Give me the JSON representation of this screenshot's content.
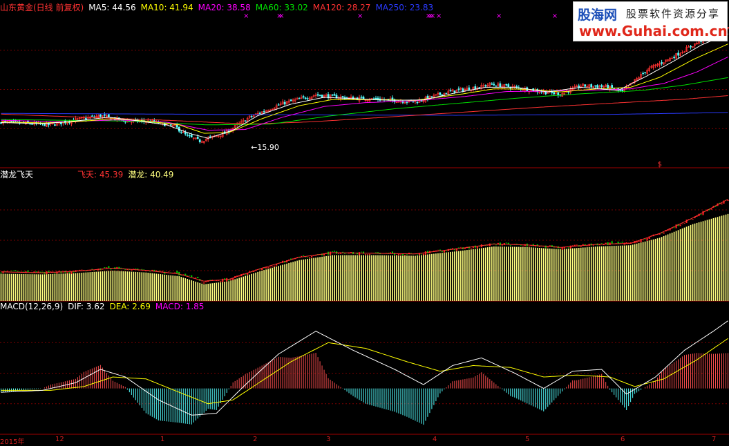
{
  "colors": {
    "background": "#000000",
    "grid": "#7a0000",
    "up_candle": "#ff3232",
    "down_candle": "#54ffff",
    "ma5": "#ffffff",
    "ma10": "#ffff00",
    "ma20": "#ff00ff",
    "ma60": "#00e000",
    "ma120": "#ff3232",
    "ma250": "#2a3aff",
    "feitian": "#ff3232",
    "qianlong": "#ffff80",
    "dif": "#ffffff",
    "dea": "#ffff00",
    "macd": "#ff00ff",
    "macd_pos": "#ff5050",
    "macd_neg": "#54ffff",
    "signal_mark": "#ff00ff"
  },
  "main_panel": {
    "title": "山东黄金(日线 前复权)",
    "indicators": [
      {
        "label": "MA5:",
        "value": "44.56",
        "color": "#ffffff"
      },
      {
        "label": "MA10:",
        "value": "41.94",
        "color": "#ffff00"
      },
      {
        "label": "MA20:",
        "value": "38.58",
        "color": "#ff00ff"
      },
      {
        "label": "MA60:",
        "value": "33.02",
        "color": "#00e000"
      },
      {
        "label": "MA120:",
        "value": "28.27",
        "color": "#ff3232"
      },
      {
        "label": "MA250:",
        "value": "23.83",
        "color": "#2a3aff"
      }
    ],
    "min_annotation": "←15.90",
    "signal_glyph": "×",
    "dollar_mark": "$"
  },
  "indicator_panel": {
    "title": "潜龙飞天",
    "values": [
      {
        "label": "飞天:",
        "value": "45.39",
        "color": "#ff3232"
      },
      {
        "label": "潜龙:",
        "value": "40.49",
        "color": "#ffff80"
      }
    ]
  },
  "macd_panel": {
    "title": "MACD(12,26,9)",
    "values": [
      {
        "label": "DIF:",
        "value": "3.62",
        "color": "#ffffff"
      },
      {
        "label": "DEA:",
        "value": "2.69",
        "color": "#ffff00"
      },
      {
        "label": "MACD:",
        "value": "1.85",
        "color": "#ff00ff"
      }
    ]
  },
  "watermark": {
    "logo": "股海网",
    "slogan": "股票软件资源分享",
    "url": "www.Guhai.com.cn"
  },
  "date_axis": [
    "2015年",
    "12",
    "1",
    "2",
    "3",
    "4",
    "5",
    "6",
    "7"
  ],
  "chart_data": {
    "type": "candlestick",
    "series_anchor_points": {
      "close": [
        [
          0,
          21.4
        ],
        [
          12,
          21.0
        ],
        [
          24,
          20.6
        ],
        [
          36,
          21.9
        ],
        [
          48,
          23.0
        ],
        [
          60,
          21.6
        ],
        [
          72,
          21.5
        ],
        [
          84,
          20.2
        ],
        [
          90,
          17.6
        ],
        [
          96,
          16.4
        ],
        [
          108,
          18.4
        ],
        [
          120,
          22.6
        ],
        [
          136,
          26.2
        ],
        [
          152,
          28.4
        ],
        [
          168,
          27.6
        ],
        [
          184,
          27.2
        ],
        [
          200,
          26.6
        ],
        [
          216,
          29.2
        ],
        [
          232,
          30.6
        ],
        [
          236,
          31.2
        ],
        [
          248,
          30.4
        ],
        [
          262,
          29.2
        ],
        [
          270,
          28.6
        ],
        [
          280,
          30.8
        ],
        [
          292,
          30.6
        ],
        [
          300,
          29.2
        ],
        [
          312,
          35.0
        ],
        [
          324,
          38.2
        ],
        [
          336,
          42.0
        ],
        [
          344,
          44.6
        ],
        [
          352,
          46.6
        ]
      ],
      "ma5": [
        [
          0,
          21.2
        ],
        [
          20,
          20.9
        ],
        [
          36,
          21.6
        ],
        [
          52,
          22.6
        ],
        [
          64,
          21.8
        ],
        [
          80,
          20.6
        ],
        [
          92,
          18.2
        ],
        [
          100,
          17.1
        ],
        [
          112,
          19.2
        ],
        [
          124,
          23.0
        ],
        [
          140,
          26.0
        ],
        [
          156,
          27.8
        ],
        [
          172,
          27.4
        ],
        [
          188,
          27.0
        ],
        [
          204,
          27.1
        ],
        [
          220,
          29.0
        ],
        [
          234,
          30.4
        ],
        [
          248,
          30.4
        ],
        [
          264,
          29.2
        ],
        [
          280,
          30.4
        ],
        [
          298,
          29.6
        ],
        [
          312,
          33.4
        ],
        [
          326,
          37.6
        ],
        [
          338,
          41.4
        ],
        [
          352,
          44.56
        ]
      ],
      "ma10": [
        [
          0,
          21.4
        ],
        [
          20,
          21.1
        ],
        [
          36,
          21.4
        ],
        [
          54,
          22.2
        ],
        [
          70,
          21.6
        ],
        [
          86,
          20.6
        ],
        [
          98,
          18.4
        ],
        [
          110,
          18.6
        ],
        [
          126,
          22.2
        ],
        [
          144,
          25.6
        ],
        [
          160,
          27.2
        ],
        [
          180,
          27.2
        ],
        [
          200,
          27.0
        ],
        [
          222,
          28.6
        ],
        [
          238,
          30.0
        ],
        [
          254,
          29.9
        ],
        [
          270,
          29.2
        ],
        [
          288,
          30.0
        ],
        [
          304,
          30.4
        ],
        [
          318,
          33.0
        ],
        [
          334,
          37.6
        ],
        [
          352,
          41.94
        ]
      ],
      "ma20": [
        [
          0,
          21.8
        ],
        [
          30,
          21.4
        ],
        [
          56,
          21.9
        ],
        [
          80,
          21.3
        ],
        [
          100,
          19.2
        ],
        [
          118,
          19.4
        ],
        [
          136,
          22.6
        ],
        [
          156,
          25.4
        ],
        [
          176,
          26.4
        ],
        [
          200,
          26.9
        ],
        [
          224,
          28.0
        ],
        [
          244,
          29.3
        ],
        [
          264,
          29.4
        ],
        [
          288,
          29.7
        ],
        [
          304,
          30.0
        ],
        [
          320,
          31.4
        ],
        [
          336,
          34.4
        ],
        [
          352,
          38.58
        ]
      ],
      "ma60": [
        [
          0,
          22.0
        ],
        [
          60,
          21.6
        ],
        [
          100,
          20.6
        ],
        [
          130,
          20.8
        ],
        [
          160,
          23.0
        ],
        [
          190,
          24.8
        ],
        [
          220,
          26.2
        ],
        [
          250,
          27.6
        ],
        [
          280,
          28.7
        ],
        [
          310,
          29.6
        ],
        [
          330,
          31.0
        ],
        [
          352,
          33.02
        ]
      ],
      "ma120": [
        [
          0,
          23.4
        ],
        [
          40,
          22.6
        ],
        [
          80,
          21.8
        ],
        [
          120,
          20.8
        ],
        [
          150,
          21.4
        ],
        [
          180,
          22.4
        ],
        [
          220,
          23.8
        ],
        [
          260,
          25.2
        ],
        [
          300,
          26.4
        ],
        [
          330,
          27.3
        ],
        [
          352,
          28.27
        ]
      ],
      "ma250": [
        [
          0,
          23.6
        ],
        [
          80,
          23.4
        ],
        [
          150,
          23.2
        ],
        [
          220,
          23.1
        ],
        [
          290,
          23.3
        ],
        [
          352,
          23.83
        ]
      ],
      "dif": [
        [
          0,
          -0.2
        ],
        [
          20,
          -0.1
        ],
        [
          36,
          0.3
        ],
        [
          48,
          1.0
        ],
        [
          60,
          0.6
        ],
        [
          76,
          -0.6
        ],
        [
          92,
          -1.4
        ],
        [
          104,
          -1.3
        ],
        [
          118,
          0.2
        ],
        [
          134,
          1.8
        ],
        [
          152,
          3.0
        ],
        [
          170,
          2.0
        ],
        [
          190,
          1.0
        ],
        [
          204,
          0.2
        ],
        [
          218,
          1.2
        ],
        [
          232,
          1.6
        ],
        [
          248,
          0.8
        ],
        [
          262,
          0.0
        ],
        [
          276,
          0.9
        ],
        [
          290,
          1.0
        ],
        [
          302,
          -0.3
        ],
        [
          316,
          0.6
        ],
        [
          330,
          2.0
        ],
        [
          344,
          3.0
        ],
        [
          352,
          3.62
        ]
      ],
      "dea": [
        [
          0,
          -0.1
        ],
        [
          24,
          -0.1
        ],
        [
          40,
          0.1
        ],
        [
          54,
          0.6
        ],
        [
          70,
          0.5
        ],
        [
          86,
          -0.2
        ],
        [
          100,
          -0.8
        ],
        [
          112,
          -0.6
        ],
        [
          126,
          0.4
        ],
        [
          140,
          1.4
        ],
        [
          158,
          2.4
        ],
        [
          176,
          2.1
        ],
        [
          196,
          1.4
        ],
        [
          212,
          0.9
        ],
        [
          228,
          1.2
        ],
        [
          246,
          1.1
        ],
        [
          262,
          0.6
        ],
        [
          278,
          0.7
        ],
        [
          294,
          0.6
        ],
        [
          306,
          0.1
        ],
        [
          320,
          0.5
        ],
        [
          336,
          1.5
        ],
        [
          352,
          2.69
        ]
      ],
      "qianlong": [
        [
          0,
          21.0
        ],
        [
          20,
          20.8
        ],
        [
          36,
          21.2
        ],
        [
          54,
          22.0
        ],
        [
          70,
          21.4
        ],
        [
          86,
          20.2
        ],
        [
          98,
          17.6
        ],
        [
          110,
          18.6
        ],
        [
          126,
          22.0
        ],
        [
          144,
          25.4
        ],
        [
          160,
          27.0
        ],
        [
          180,
          27.0
        ],
        [
          200,
          26.8
        ],
        [
          222,
          28.4
        ],
        [
          238,
          29.8
        ],
        [
          254,
          29.6
        ],
        [
          270,
          28.9
        ],
        [
          288,
          29.8
        ],
        [
          304,
          30.2
        ],
        [
          318,
          32.6
        ],
        [
          334,
          37.0
        ],
        [
          352,
          40.49
        ]
      ],
      "feitian": [
        [
          0,
          21.6
        ],
        [
          20,
          21.3
        ],
        [
          36,
          21.8
        ],
        [
          54,
          22.8
        ],
        [
          70,
          22.1
        ],
        [
          86,
          20.9
        ],
        [
          98,
          18.6
        ],
        [
          110,
          19.2
        ],
        [
          126,
          22.8
        ],
        [
          144,
          26.3
        ],
        [
          160,
          27.8
        ],
        [
          180,
          27.6
        ],
        [
          200,
          27.4
        ],
        [
          222,
          29.2
        ],
        [
          238,
          30.6
        ],
        [
          254,
          30.3
        ],
        [
          270,
          29.5
        ],
        [
          288,
          30.5
        ],
        [
          304,
          30.8
        ],
        [
          318,
          34.0
        ],
        [
          334,
          39.0
        ],
        [
          352,
          45.39
        ]
      ]
    },
    "bar_count": 352,
    "y_ranges": {
      "main": [
        9.4,
        50.3
      ],
      "indicator": [
        12.2,
        51.4
      ],
      "macd": [
        -2.4,
        4.0
      ]
    },
    "min_price": 15.9,
    "date_axis_labels": [
      "2015年",
      "12",
      "1",
      "2",
      "3",
      "4",
      "5",
      "6",
      "7"
    ],
    "grid": true
  }
}
